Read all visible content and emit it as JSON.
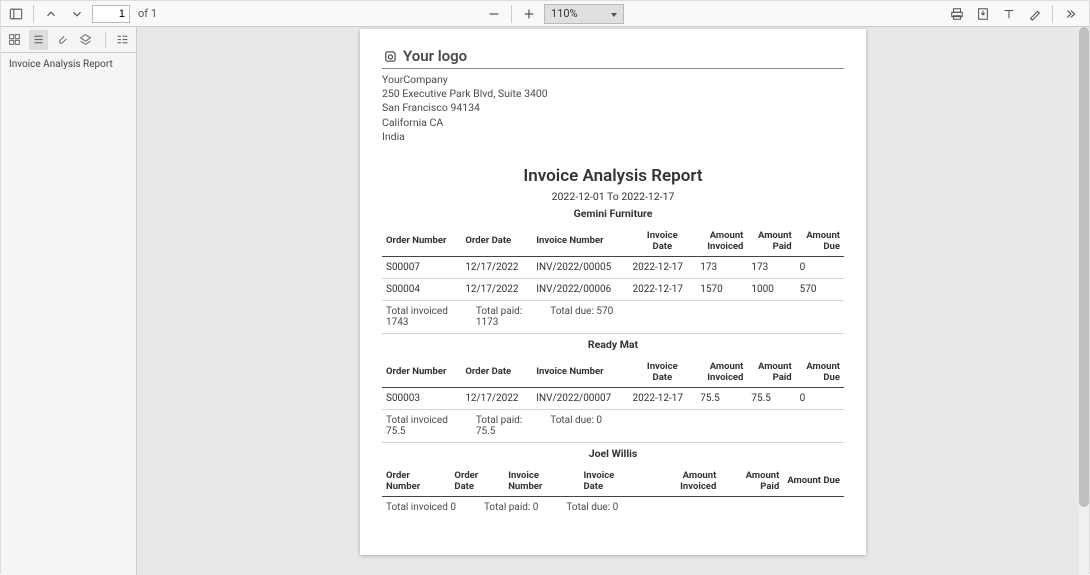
{
  "toolbar": {
    "page_current": "1",
    "page_total_label": "of 1",
    "zoom": "110%"
  },
  "sidebar": {
    "outline_item": "Invoice Analysis Report"
  },
  "doc": {
    "logo_text": "Your logo",
    "company": {
      "name": "YourCompany",
      "street": "250 Executive Park Blvd, Suite 3400",
      "city": "San Francisco 94134",
      "state": "California CA",
      "country": "India"
    },
    "title": "Invoice Analysis Report",
    "date_range": "2022-12-01 To 2022-12-17",
    "headers": {
      "order_number": "Order Number",
      "order_date": "Order Date",
      "invoice_number": "Invoice Number",
      "invoice_date": "Invoice Date",
      "invoice_date_l1": "Invoice",
      "invoice_date_l2": "Date",
      "amount_invoiced": "Amount Invoiced",
      "amount_invoiced_l1": "Amount",
      "amount_invoiced_l2": "Invoiced",
      "amount_paid": "Amount Paid",
      "amount_paid_l1": "Amount",
      "amount_paid_l2": "Paid",
      "amount_due": "Amount Due",
      "amount_due_l1": "Amount",
      "amount_due_l2": "Due"
    },
    "partners": [
      {
        "name": "Gemini Furniture",
        "rows": [
          {
            "order_number": "S00007",
            "order_date": "12/17/2022",
            "invoice_number": "INV/2022/00005",
            "invoice_date": "2022-12-17",
            "amount_invoiced": "173",
            "amount_paid": "173",
            "amount_due": "0"
          },
          {
            "order_number": "S00004",
            "order_date": "12/17/2022",
            "invoice_number": "INV/2022/00006",
            "invoice_date": "2022-12-17",
            "amount_invoiced": "1570",
            "amount_paid": "1000",
            "amount_due": "570"
          }
        ],
        "totals": {
          "invoiced_label": "Total invoiced",
          "invoiced": "1743",
          "paid_label": "Total paid:",
          "paid": "1173",
          "due_label": "Total due:",
          "due": "570"
        }
      },
      {
        "name": "Ready Mat",
        "rows": [
          {
            "order_number": "S00003",
            "order_date": "12/17/2022",
            "invoice_number": "INV/2022/00007",
            "invoice_date": "2022-12-17",
            "amount_invoiced": "75.5",
            "amount_paid": "75.5",
            "amount_due": "0"
          }
        ],
        "totals": {
          "invoiced_label": "Total invoiced",
          "invoiced": "75.5",
          "paid_label": "Total paid:",
          "paid": "75.5",
          "due_label": "Total due:",
          "due": "0"
        }
      },
      {
        "name": "Joel Willis",
        "rows": [],
        "totals": {
          "invoiced_label": "Total invoiced 0",
          "invoiced": "",
          "paid_label": "Total paid: 0",
          "paid": "",
          "due_label": "Total due: 0",
          "due": ""
        }
      }
    ]
  }
}
